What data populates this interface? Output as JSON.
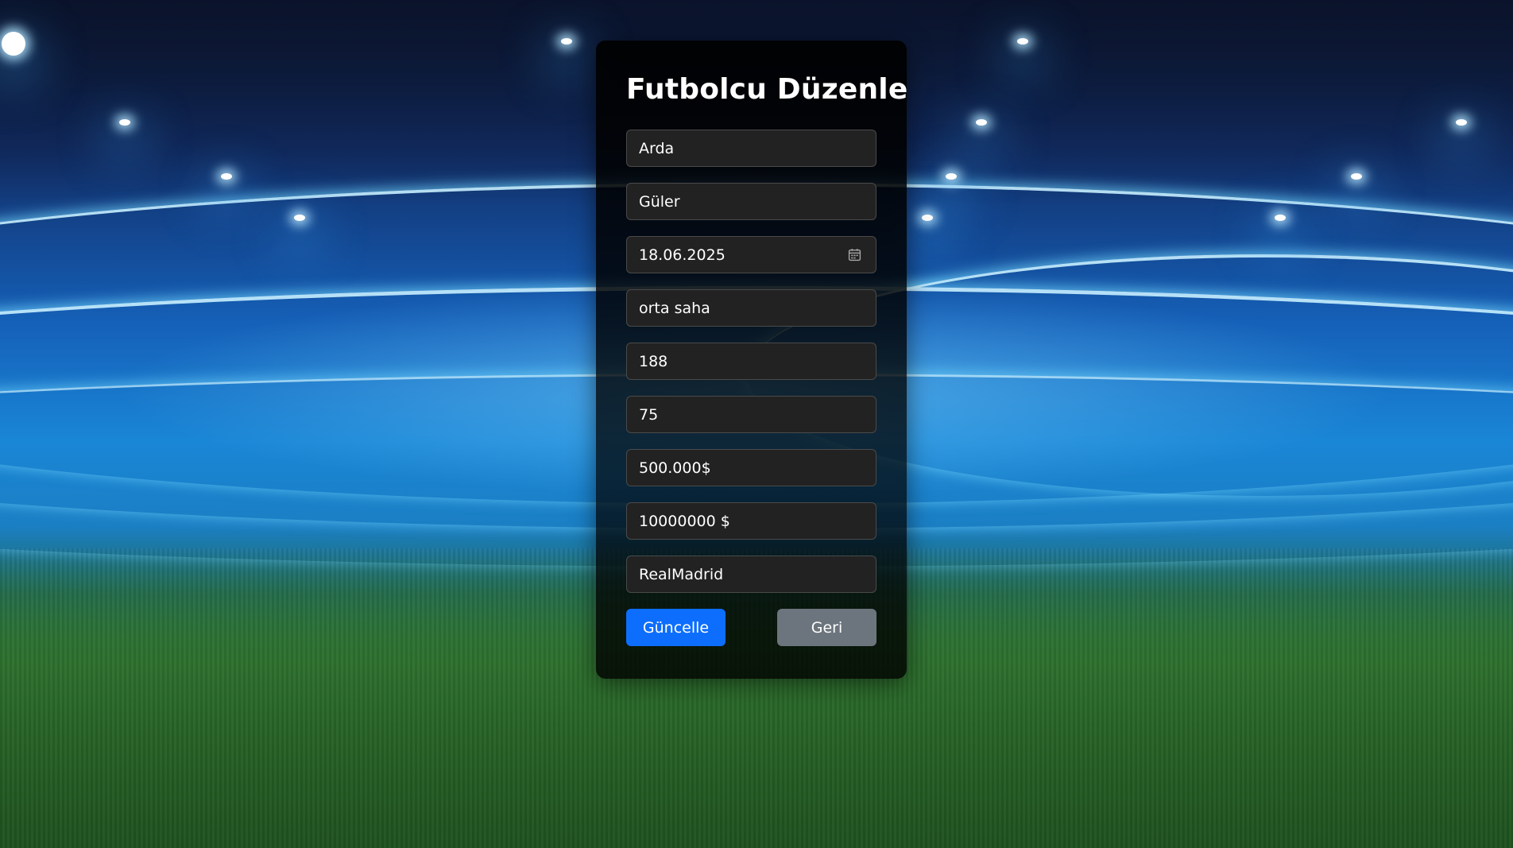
{
  "form": {
    "title": "Futbolcu Düzenle",
    "fields": {
      "first_name": "Arda",
      "last_name": "Güler",
      "birth_date": "18.06.2025",
      "position": "orta saha",
      "height": "188",
      "weight": "75",
      "salary": "500.000$",
      "market_value": "10000000 $",
      "team": "RealMadrid"
    },
    "update_label": "Güncelle",
    "back_label": "Geri"
  },
  "icons": {
    "date_picker": "calendar-icon"
  },
  "colors": {
    "primary_button": "#0d6efd",
    "secondary_button": "#6c757d",
    "input_background": "#222222"
  }
}
